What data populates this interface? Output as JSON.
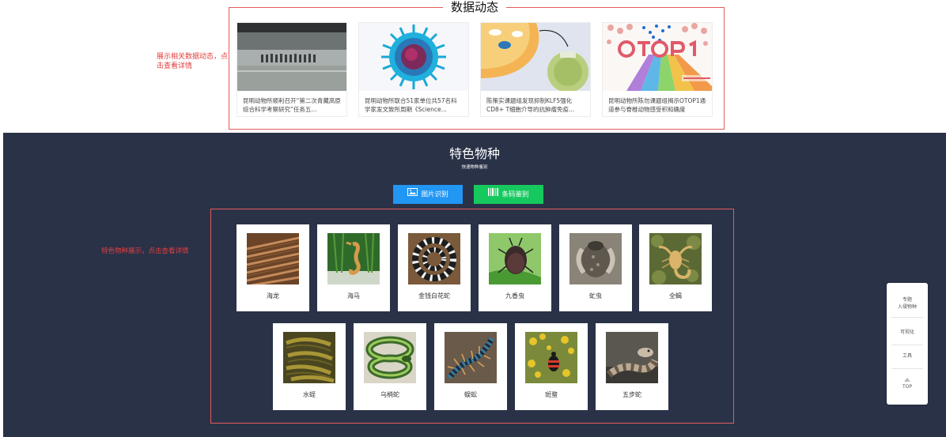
{
  "news": {
    "title": "数据动态",
    "note": "展示相关数据动态，点击查看详情",
    "cards": [
      {
        "caption": "昆明动物所顺利召开“第二次青藏高原综合科学考察研究”任务五...",
        "thumb": "crowd-photo"
      },
      {
        "caption": "昆明动物所联合51家单位共57名科学家发文致所周期《Science...",
        "thumb": "virus-illustration"
      },
      {
        "caption": "陈策实课题组发现抑制KLF5强化CD8+ T细胞介导的抗肿瘤免疫...",
        "thumb": "cell-diagram"
      },
      {
        "caption": "昆明动物所陈勿课题组揭示OTOP1通道参与脊椎动物感受积和确度",
        "thumb": "otop1-diagram"
      }
    ]
  },
  "species": {
    "title": "特色物种",
    "subtitle": "快速物种鉴别",
    "photo_button": "图片识别",
    "barcode_button": "条码鉴别",
    "note": "特色物种展示，点击查看详情",
    "row1": [
      {
        "name": "海龙",
        "icon": "pipefish-photo"
      },
      {
        "name": "海马",
        "icon": "seahorse-photo"
      },
      {
        "name": "金钱白花蛇",
        "icon": "banded-krait-photo"
      },
      {
        "name": "九香虫",
        "icon": "stink-bug-photo"
      },
      {
        "name": "虻虫",
        "icon": "horsefly-photo"
      },
      {
        "name": "全蝎",
        "icon": "scorpion-photo"
      }
    ],
    "row2": [
      {
        "name": "水蛭",
        "icon": "leech-photo"
      },
      {
        "name": "乌梢蛇",
        "icon": "rat-snake-photo"
      },
      {
        "name": "蜈蚣",
        "icon": "centipede-photo"
      },
      {
        "name": "斑蝥",
        "icon": "blister-beetle-photo"
      },
      {
        "name": "五步蛇",
        "icon": "pit-viper-photo"
      }
    ]
  },
  "sidebar": {
    "item1_line1": "专题",
    "item1_line2": "入侵物种",
    "item2": "可视化",
    "item3": "工具",
    "top": "TOP"
  },
  "colors": {
    "dark_bg": "#2a3248",
    "photo_button": "#2196f3",
    "barcode_button": "#16c95e",
    "annotation": "#e45b5b"
  }
}
